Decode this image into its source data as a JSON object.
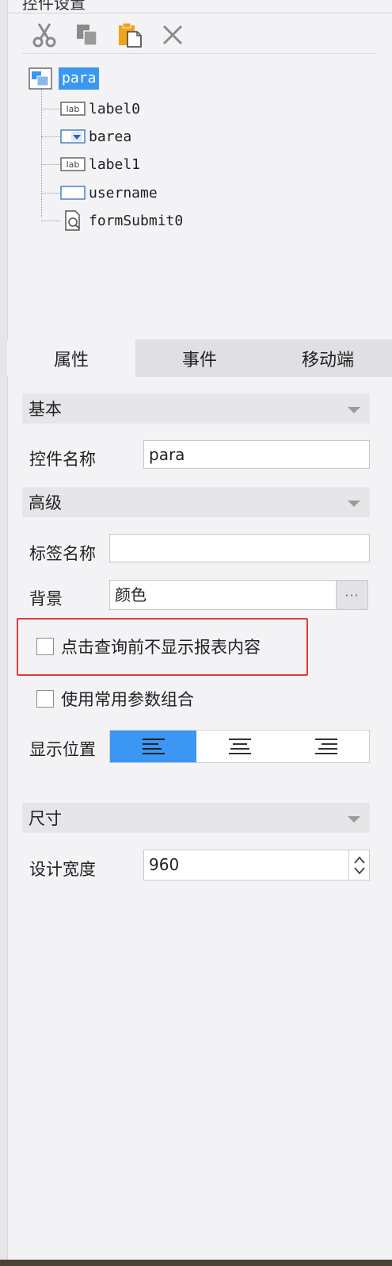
{
  "panel": {
    "title": "控件设置"
  },
  "toolbar": {
    "cut": "scissors-icon",
    "copy": "copy-icon",
    "paste": "paste-icon",
    "delete": "close-icon"
  },
  "tree": {
    "root": "para",
    "items": [
      "label0",
      "barea",
      "label1",
      "username",
      "formSubmit0"
    ]
  },
  "tabs": [
    "属性",
    "事件",
    "移动端"
  ],
  "sections": {
    "basic": "基本",
    "advanced": "高级",
    "size": "尺寸"
  },
  "fields": {
    "widget_name_label": "控件名称",
    "widget_name_value": "para",
    "tag_name_label": "标签名称",
    "tag_name_value": "",
    "background_label": "背景",
    "background_value": "颜色",
    "background_button": "···",
    "hide_before_query": "点击查询前不显示报表内容",
    "use_common_params": "使用常用参数组合",
    "position_label": "显示位置",
    "design_width_label": "设计宽度",
    "design_width_value": "960"
  },
  "colors": {
    "accent": "#3c96f3",
    "highlight": "#e23a3a",
    "paste_icon": "#f0a21a"
  }
}
